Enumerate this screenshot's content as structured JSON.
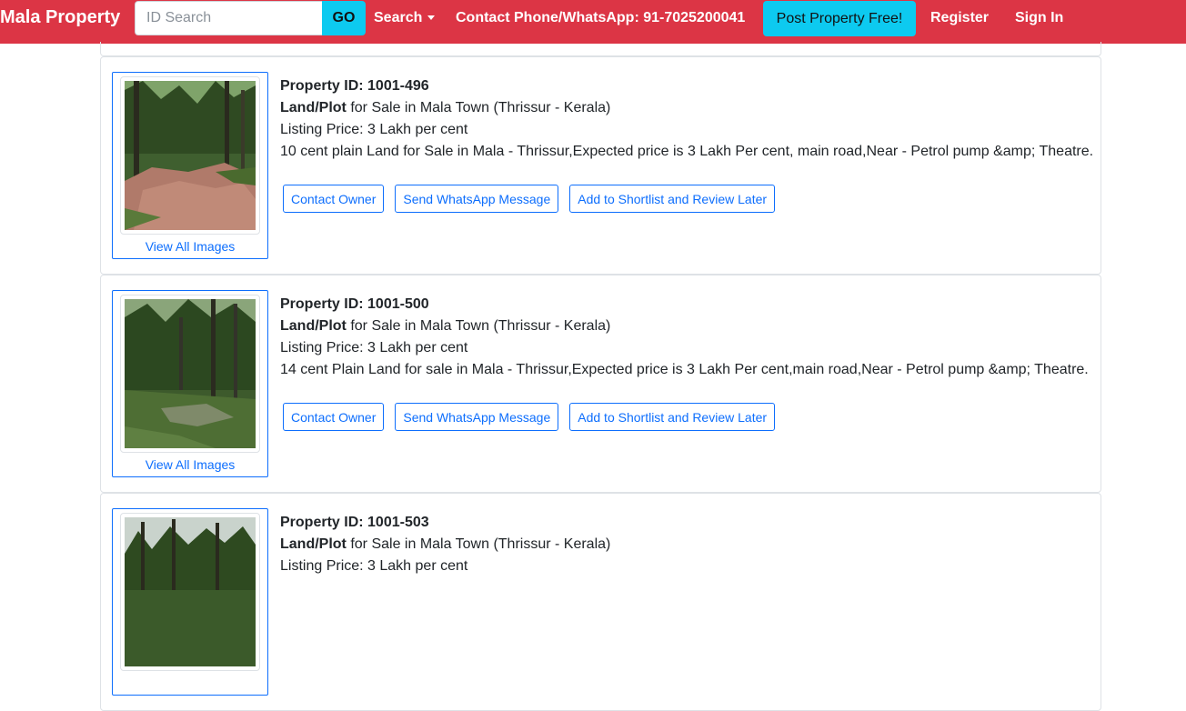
{
  "navbar": {
    "brand": "Mala Property",
    "id_search_placeholder": "ID Search",
    "go_label": "GO",
    "search_label": "Search",
    "contact_text": "Contact Phone/WhatsApp: 91-7025200041",
    "post_label": "Post Property Free!",
    "register_label": "Register",
    "signin_label": "Sign In"
  },
  "listings": [
    {
      "property_id": "Property ID: 1001-496",
      "type": "Land/Plot",
      "location": " for Sale in Mala Town (Thrissur - Kerala)",
      "price": "Listing Price: 3 Lakh per cent",
      "description": "10 cent plain Land for Sale in Mala - Thrissur,Expected price is 3 Lakh Per cent, main road,Near - Petrol pump &amp; Theatre.",
      "view_images": "View All Images",
      "contact_label": "Contact Owner",
      "whatsapp_label": "Send WhatsApp Message",
      "shortlist_label": "Add to Shortlist and Review Later"
    },
    {
      "property_id": "Property ID: 1001-500",
      "type": "Land/Plot",
      "location": " for Sale in Mala Town (Thrissur - Kerala)",
      "price": "Listing Price: 3 Lakh per cent",
      "description": "14 cent Plain Land for sale in Mala - Thrissur,Expected price is 3 Lakh Per cent,main road,Near - Petrol pump &amp; Theatre.",
      "view_images": "View All Images",
      "contact_label": "Contact Owner",
      "whatsapp_label": "Send WhatsApp Message",
      "shortlist_label": "Add to Shortlist and Review Later"
    },
    {
      "property_id": "Property ID: 1001-503",
      "type": "Land/Plot",
      "location": " for Sale in Mala Town (Thrissur - Kerala)",
      "price": "Listing Price: 3 Lakh per cent"
    }
  ],
  "colors": {
    "navbar_bg": "#dc3545",
    "info_button": "#0dcaf0",
    "link_blue": "#0d6efd"
  }
}
